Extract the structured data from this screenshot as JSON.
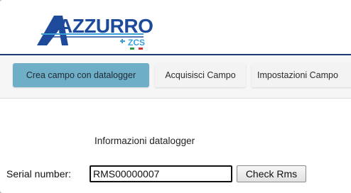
{
  "brand": {
    "name": "AZZURRO",
    "sub": "ZCS",
    "colors": {
      "primary": "#1e4a9c",
      "accent": "#3aa0d8",
      "italy_green": "#2e9b3e",
      "italy_red": "#d0312d"
    }
  },
  "tabs": [
    {
      "label": "Crea campo con datalogger",
      "active": true
    },
    {
      "label": "Acquisisci Campo",
      "active": false
    },
    {
      "label": "Impostazioni Campo",
      "active": false
    }
  ],
  "section": {
    "title": "Informazioni datalogger"
  },
  "form": {
    "serial_label": "Serial number:",
    "serial_value": "RMS00000007",
    "check_button": "Check Rms"
  }
}
